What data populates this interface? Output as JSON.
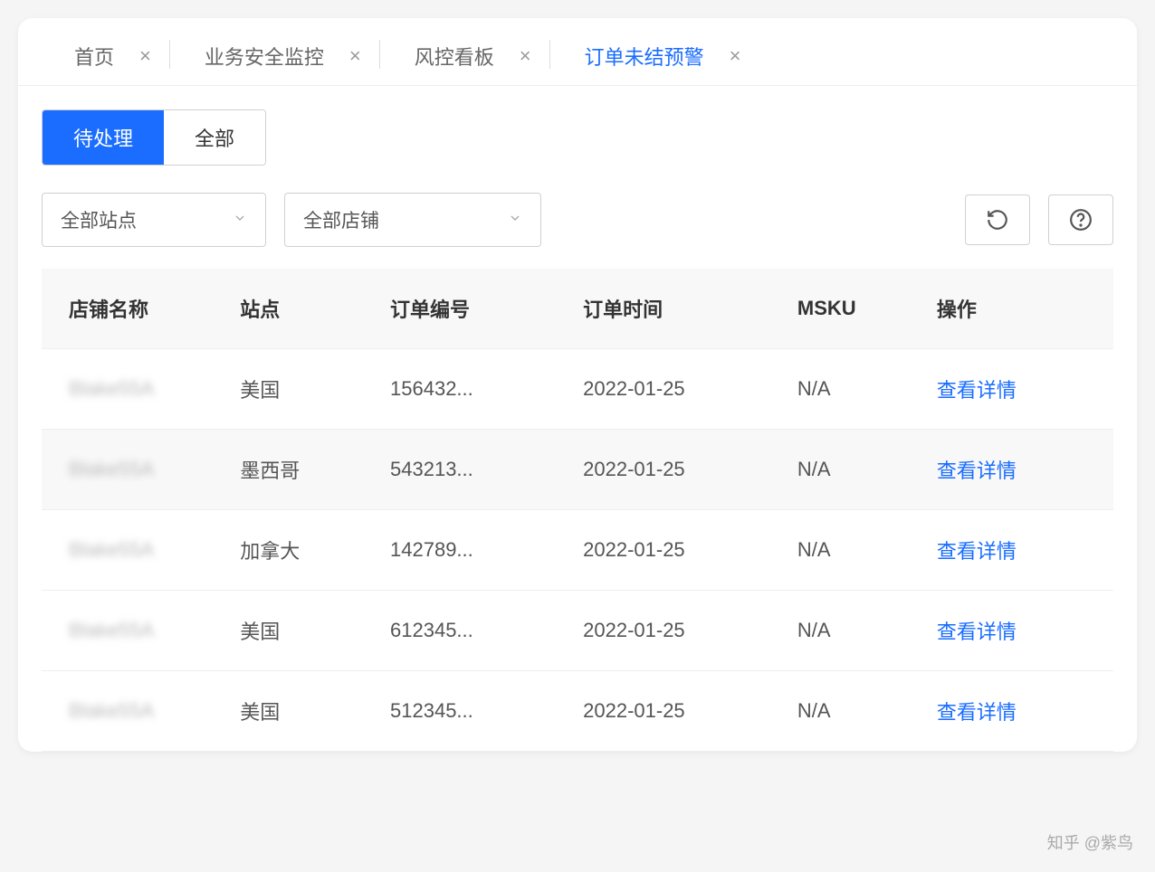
{
  "tabs": [
    {
      "label": "首页",
      "active": false
    },
    {
      "label": "业务安全监控",
      "active": false
    },
    {
      "label": "风控看板",
      "active": false
    },
    {
      "label": "订单未结预警",
      "active": true
    }
  ],
  "filterTabs": {
    "pending": "待处理",
    "all": "全部"
  },
  "selects": {
    "site": "全部站点",
    "store": "全部店铺"
  },
  "columns": {
    "store": "店铺名称",
    "site": "站点",
    "orderNo": "订单编号",
    "time": "订单时间",
    "msku": "MSKU",
    "action": "操作"
  },
  "actionLabel": "查看详情",
  "rows": [
    {
      "store": "Blake55A",
      "site": "美国",
      "orderNo": "156432...",
      "time": "2022-01-25",
      "msku": "N/A"
    },
    {
      "store": "Blake55A",
      "site": "墨西哥",
      "orderNo": "543213...",
      "time": "2022-01-25",
      "msku": "N/A"
    },
    {
      "store": "Blake55A",
      "site": "加拿大",
      "orderNo": "142789...",
      "time": "2022-01-25",
      "msku": "N/A"
    },
    {
      "store": "Blake55A",
      "site": "美国",
      "orderNo": "612345...",
      "time": "2022-01-25",
      "msku": "N/A"
    },
    {
      "store": "Blake55A",
      "site": "美国",
      "orderNo": "512345...",
      "time": "2022-01-25",
      "msku": "N/A"
    }
  ],
  "watermark": "知乎 @紫鸟"
}
